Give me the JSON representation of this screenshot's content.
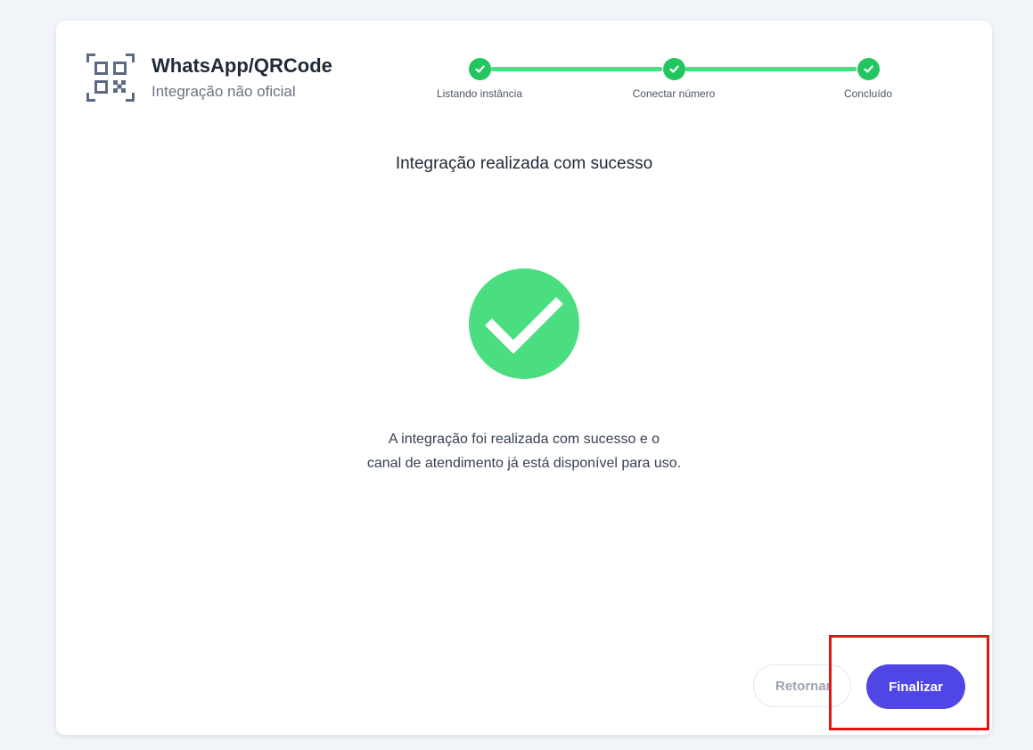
{
  "header": {
    "title": "WhatsApp/QRCode",
    "subtitle": "Integração não oficial",
    "icon": "qr-code-icon"
  },
  "stepper": {
    "steps": [
      {
        "label": "Listando instância",
        "status": "completed"
      },
      {
        "label": "Conectar número",
        "status": "completed"
      },
      {
        "label": "Concluído",
        "status": "completed"
      }
    ]
  },
  "content": {
    "title": "Integração realizada com sucesso",
    "message_line1": "A integração foi realizada com sucesso e o",
    "message_line2": "canal de atendimento já está disponível para uso.",
    "success_icon": "check-circle-icon"
  },
  "buttons": {
    "return_label": "Retornar",
    "finish_label": "Finalizar"
  },
  "colors": {
    "accent": "#4f46e5",
    "success": "#4ade80",
    "step_complete": "#22c55e",
    "highlight": "#e11414"
  }
}
